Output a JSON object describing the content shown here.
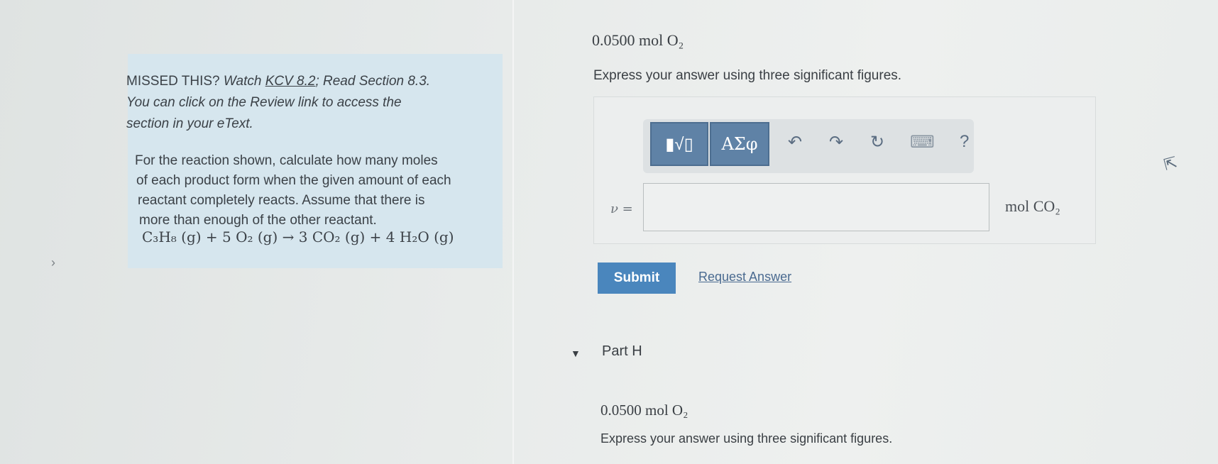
{
  "hint": {
    "missed_prefix": "MISSED THIS? ",
    "watch_text": "Watch ",
    "watch_link": "KCV 8.2",
    "read_text": "; Read Section 8.3.",
    "line2": "You can click on the Review link to access the",
    "line3": "section in your eText."
  },
  "problem": {
    "line1": "For the reaction shown, calculate how many moles",
    "line2": "of each product form when the given amount of each",
    "line3": "reactant completely reacts. Assume that there is",
    "line4": "more than enough of the other reactant.",
    "equation": "C₃H₈ (g) + 5 O₂ (g) → 3 CO₂ (g) + 4 H₂O (g)"
  },
  "part_g": {
    "given": "0.0500 mol O₂",
    "instruction": "Express your answer using three significant figures.",
    "toolbar": {
      "templates_label": "▮√▯",
      "greek_label": "ΑΣφ",
      "undo_icon": "↶",
      "redo_icon": "↷",
      "reset_icon": "↻",
      "keyboard_icon": "⌨",
      "help_label": "?"
    },
    "variable_label": "ν =",
    "input_value": "",
    "unit": "mol CO₂",
    "submit_label": "Submit",
    "request_label": "Request Answer"
  },
  "part_h": {
    "title": "Part H",
    "given": "0.0500 mol O₂",
    "instruction": "Express your answer using three significant figures."
  },
  "nav": {
    "collapse_icon": "›",
    "caret_icon": "▼"
  }
}
